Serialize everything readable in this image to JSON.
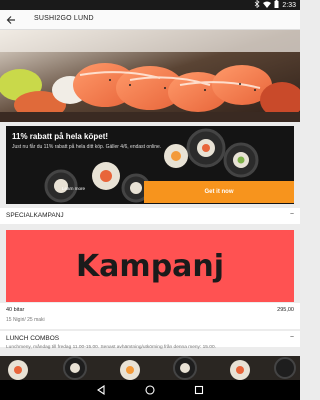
{
  "status_bar": {
    "time": "2:33",
    "icons": [
      "bluetooth-icon",
      "wifi-icon",
      "battery-icon"
    ]
  },
  "app_bar": {
    "title": "SUSHI2GO LUND",
    "back_icon": "back-arrow-icon"
  },
  "promo": {
    "title": "11% rabatt på hela köpet!",
    "text": "Just nu får du 11% rabatt på hela ditt köp. Gäller 4/6, endast online.",
    "learn_more": "Learn more",
    "cta": "Get it now",
    "cta_color": "#f7941d"
  },
  "sections": {
    "special": {
      "label": "SPECIALKAMPANJ",
      "toggle": "−"
    },
    "lunch": {
      "label": "LUNCH COMBOS",
      "toggle": "−",
      "description": "Lunchmeny, måndag till fredag 11.00-15.00. Senast avhämtning/utkörning från denna meny: 15.00."
    }
  },
  "campaign": {
    "text": "Kampanj",
    "background": "#ff5252"
  },
  "products": [
    {
      "name": "40 bitar",
      "price": "295,00",
      "description": "15 Nigiri/ 25 maki"
    }
  ],
  "nav_bar": {
    "icons": [
      "back-icon",
      "home-icon",
      "recents-icon"
    ]
  }
}
